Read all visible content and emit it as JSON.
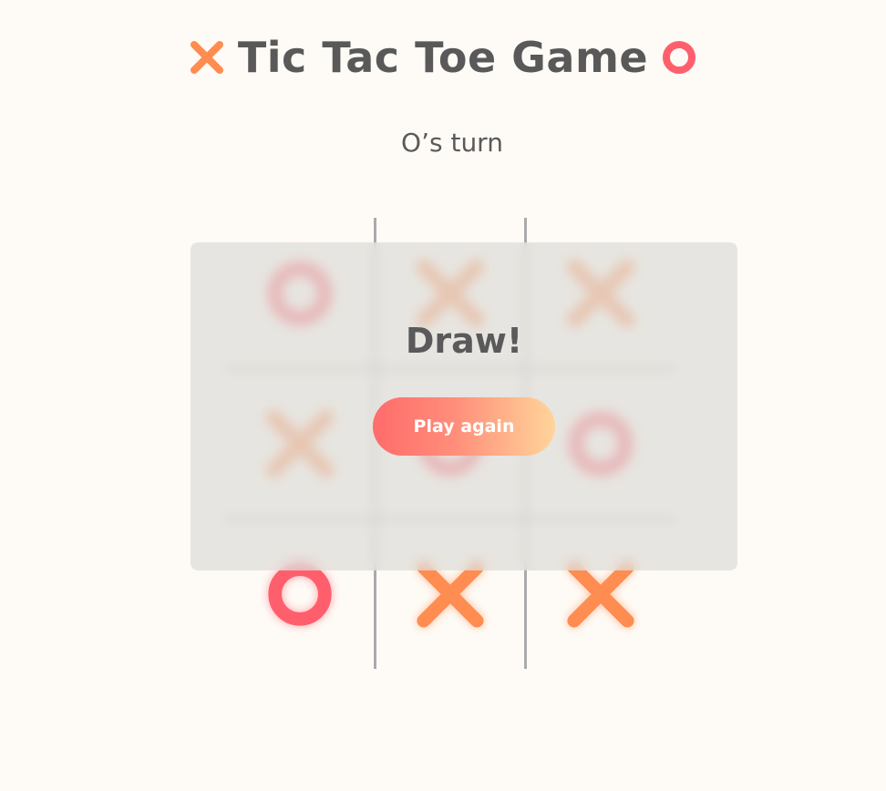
{
  "header": {
    "title": "Tic Tac Toe Game",
    "left_icon": "x-mark-icon",
    "right_icon": "o-mark-icon"
  },
  "status": {
    "text": "O’s turn"
  },
  "board": {
    "cells": [
      "O",
      "X",
      "X",
      "X",
      "O",
      "O",
      "O",
      "X",
      "X"
    ]
  },
  "result_dialog": {
    "message": "Draw!",
    "button_label": "Play again"
  },
  "colors": {
    "background": "#fefbf6",
    "x_mark": "#ff8c50",
    "o_mark": "#ff5f6d",
    "grid_line": "#aaaaaa",
    "text": "#595959",
    "button_gradient_start": "#ff6b6b",
    "button_gradient_end": "#ffd59a"
  }
}
